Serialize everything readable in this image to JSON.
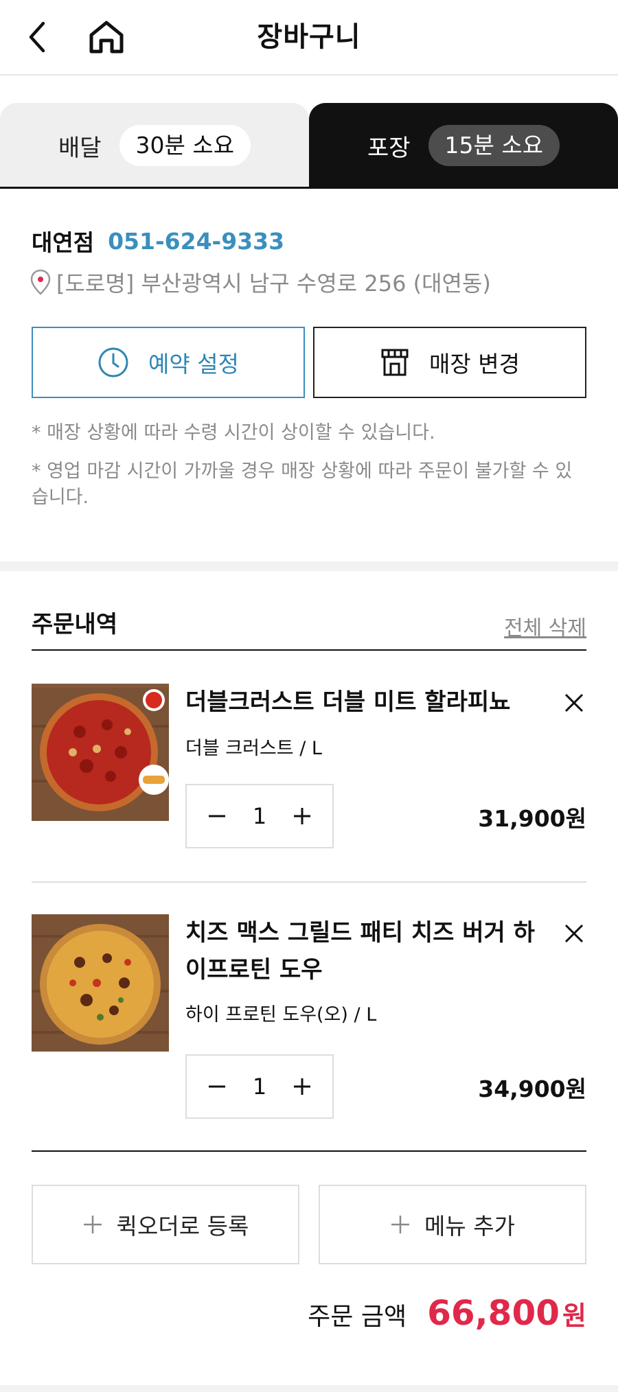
{
  "header": {
    "title": "장바구니",
    "back_icon": "chevron-left-icon",
    "home_icon": "home-icon"
  },
  "tabs": [
    {
      "label": "배달",
      "eta": "30분 소요",
      "selected": false
    },
    {
      "label": "포장",
      "eta": "15분 소요",
      "selected": true
    }
  ],
  "store": {
    "name": "대연점",
    "phone": "051-624-9333",
    "address": "[도로명] 부산광역시 남구 수영로 256 (대연동)"
  },
  "buttons": {
    "reserve": "예약 설정",
    "change_store": "매장 변경"
  },
  "notes": [
    "* 매장 상황에 따라 수령 시간이 상이할 수 있습니다.",
    "* 영업 마감 시간이 가까울 경우 매장 상황에 따라 주문이 불가할 수 있습니다."
  ],
  "order": {
    "title": "주문내역",
    "delete_all": "전체 삭제",
    "items": [
      {
        "name": "더블크러스트 더블 미트 할라피뇨",
        "option": "더블 크러스트 / L",
        "quantity": "1",
        "price": "31,900원"
      },
      {
        "name": "치즈 맥스 그릴드 패티 치즈 버거 하이프로틴 도우",
        "option": "하이 프로틴 도우(오) / L",
        "quantity": "1",
        "price": "34,900원"
      }
    ]
  },
  "actions": {
    "quick_order": "퀵오더로 등록",
    "add_menu": "메뉴 추가"
  },
  "total": {
    "label": "주문 금액",
    "amount": "66,800",
    "unit": "원"
  },
  "colors": {
    "accent_blue": "#3a8fbd",
    "total_red": "#e0284b",
    "tab_selected": "#111111"
  }
}
